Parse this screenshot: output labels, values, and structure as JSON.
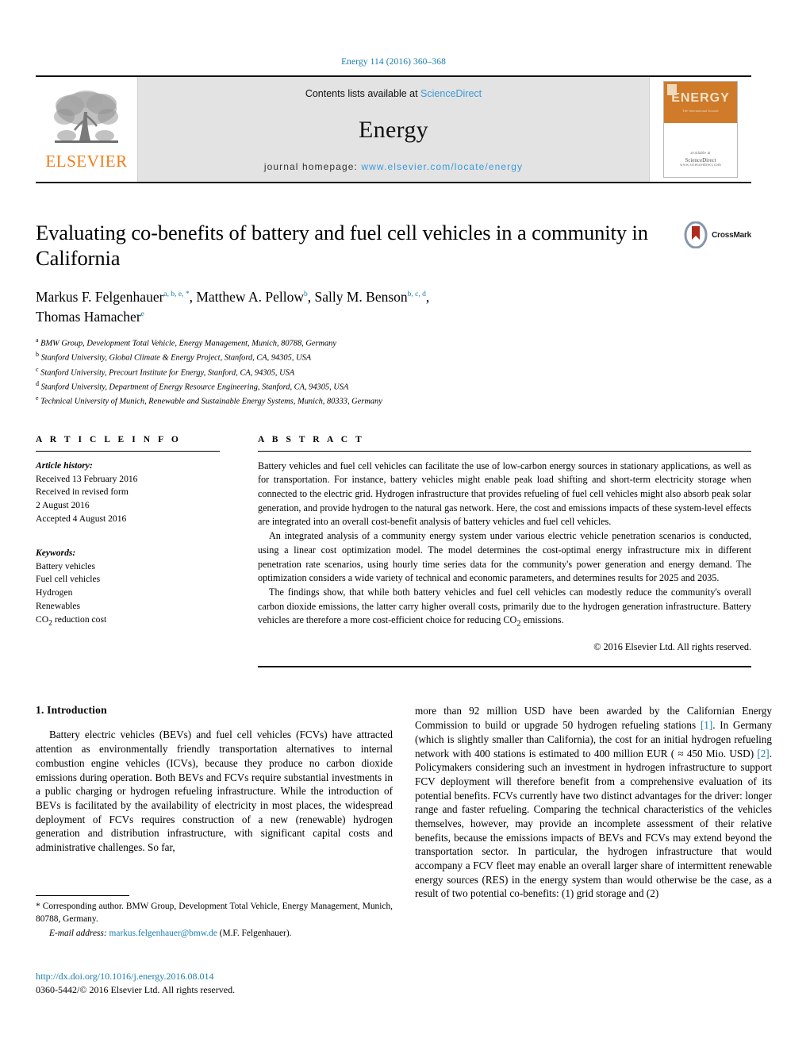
{
  "running_head": "Energy 114 (2016) 360–368",
  "masthead": {
    "publisher_logo_name": "elsevier-tree-logo",
    "publisher_word": "ELSEVIER",
    "contents_prefix": "Contents lists available at ",
    "contents_link": "ScienceDirect",
    "journal_name": "Energy",
    "homepage_prefix": "journal homepage: ",
    "homepage_url": "www.elsevier.com/locate/energy",
    "cover": {
      "title": "ENERGY",
      "subtitle": "The International Journal",
      "footer_prefix": "available at",
      "footer_brand": "ScienceDirect",
      "footer_url": "www.sciencedirect.com"
    }
  },
  "article": {
    "title": "Evaluating co-benefits of battery and fuel cell vehicles in a community in California",
    "crossmark_label": "CrossMark",
    "authors_line_1_parts": [
      {
        "name": "Markus F. Felgenhauer",
        "marks": "a, b, e, *"
      },
      {
        "name": "Matthew A. Pellow",
        "marks": "b"
      },
      {
        "name": "Sally M. Benson",
        "marks": "b, c, d"
      }
    ],
    "authors_line_2": {
      "name": "Thomas Hamacher",
      "marks": "e"
    },
    "affiliations": [
      {
        "mark": "a",
        "text": "BMW Group, Development Total Vehicle, Energy Management, Munich, 80788, Germany"
      },
      {
        "mark": "b",
        "text": "Stanford University, Global Climate & Energy Project, Stanford, CA, 94305, USA"
      },
      {
        "mark": "c",
        "text": "Stanford University, Precourt Institute for Energy, Stanford, CA, 94305, USA"
      },
      {
        "mark": "d",
        "text": "Stanford University, Department of Energy Resource Engineering, Stanford, CA, 94305, USA"
      },
      {
        "mark": "e",
        "text": "Technical University of Munich, Renewable and Sustainable Energy Systems, Munich, 80333, Germany"
      }
    ]
  },
  "article_info": {
    "heading": "A R T I C L E  I N F O",
    "history_label": "Article history:",
    "history": [
      "Received 13 February 2016",
      "Received in revised form",
      "2 August 2016",
      "Accepted 4 August 2016"
    ],
    "keywords_label": "Keywords:",
    "keywords": [
      "Battery vehicles",
      "Fuel cell vehicles",
      "Hydrogen",
      "Renewables",
      "CO2 reduction cost"
    ]
  },
  "abstract": {
    "heading": "A B S T R A C T",
    "paragraphs": [
      "Battery vehicles and fuel cell vehicles can facilitate the use of low-carbon energy sources in stationary applications, as well as for transportation. For instance, battery vehicles might enable peak load shifting and short-term electricity storage when connected to the electric grid. Hydrogen infrastructure that provides refueling of fuel cell vehicles might also absorb peak solar generation, and provide hydrogen to the natural gas network. Here, the cost and emissions impacts of these system-level effects are integrated into an overall cost-benefit analysis of battery vehicles and fuel cell vehicles.",
      "An integrated analysis of a community energy system under various electric vehicle penetration scenarios is conducted, using a linear cost optimization model. The model determines the cost-optimal energy infrastructure mix in different penetration rate scenarios, using hourly time series data for the community's power generation and energy demand. The optimization considers a wide variety of technical and economic parameters, and determines results for 2025 and 2035.",
      "The findings show, that while both battery vehicles and fuel cell vehicles can modestly reduce the community's overall carbon dioxide emissions, the latter carry higher overall costs, primarily due to the hydrogen generation infrastructure. Battery vehicles are therefore a more cost-efficient choice for reducing CO2 emissions."
    ],
    "copyright": "© 2016 Elsevier Ltd. All rights reserved."
  },
  "body": {
    "section_number": "1.",
    "section_title": "Introduction",
    "left_column": "Battery electric vehicles (BEVs) and fuel cell vehicles (FCVs) have attracted attention as environmentally friendly transportation alternatives to internal combustion engine vehicles (ICVs), because they produce no carbon dioxide emissions during operation. Both BEVs and FCVs require substantial investments in a public charging or hydrogen refueling infrastructure. While the introduction of BEVs is facilitated by the availability of electricity in most places, the widespread deployment of FCVs requires construction of a new (renewable) hydrogen generation and distribution infrastructure, with significant capital costs and administrative challenges. So far,",
    "right_column_part1": "more than 92 million USD have been awarded by the Californian Energy Commission to build or upgrade 50 hydrogen refueling stations ",
    "right_column_ref1": "[1]",
    "right_column_part2": ". In Germany (which is slightly smaller than California), the cost for an initial hydrogen refueling network with 400 stations is estimated to 400 million EUR ( ≈ 450 Mio. USD) ",
    "right_column_ref2": "[2]",
    "right_column_part3": ". Policymakers considering such an investment in hydrogen infrastructure to support FCV deployment will therefore benefit from a comprehensive evaluation of its potential benefits. FCVs currently have two distinct advantages for the driver: longer range and faster refueling. Comparing the technical characteristics of the vehicles themselves, however, may provide an incomplete assessment of their relative benefits, because the emissions impacts of BEVs and FCVs may extend beyond the transportation sector. In particular, the hydrogen infrastructure that would accompany a FCV fleet may enable an overall larger share of intermittent renewable energy sources (RES) in the energy system than would otherwise be the case, as a result of two potential co-benefits: (1) grid storage and (2)"
  },
  "footnote": {
    "corresponding": "* Corresponding author. BMW Group, Development Total Vehicle, Energy Management, Munich, 80788, Germany.",
    "email_label": "E-mail address:",
    "email": "markus.felgenhauer@bmw.de",
    "email_suffix": "(M.F. Felgenhauer)."
  },
  "doi": {
    "url": "http://dx.doi.org/10.1016/j.energy.2016.08.014",
    "issn_line": "0360-5442/© 2016 Elsevier Ltd. All rights reserved."
  },
  "colors": {
    "link": "#1a7cad",
    "science_direct": "#3a9ad9",
    "elsevier_orange": "#ef7d1a",
    "cover_orange": "#cf7b2a"
  }
}
